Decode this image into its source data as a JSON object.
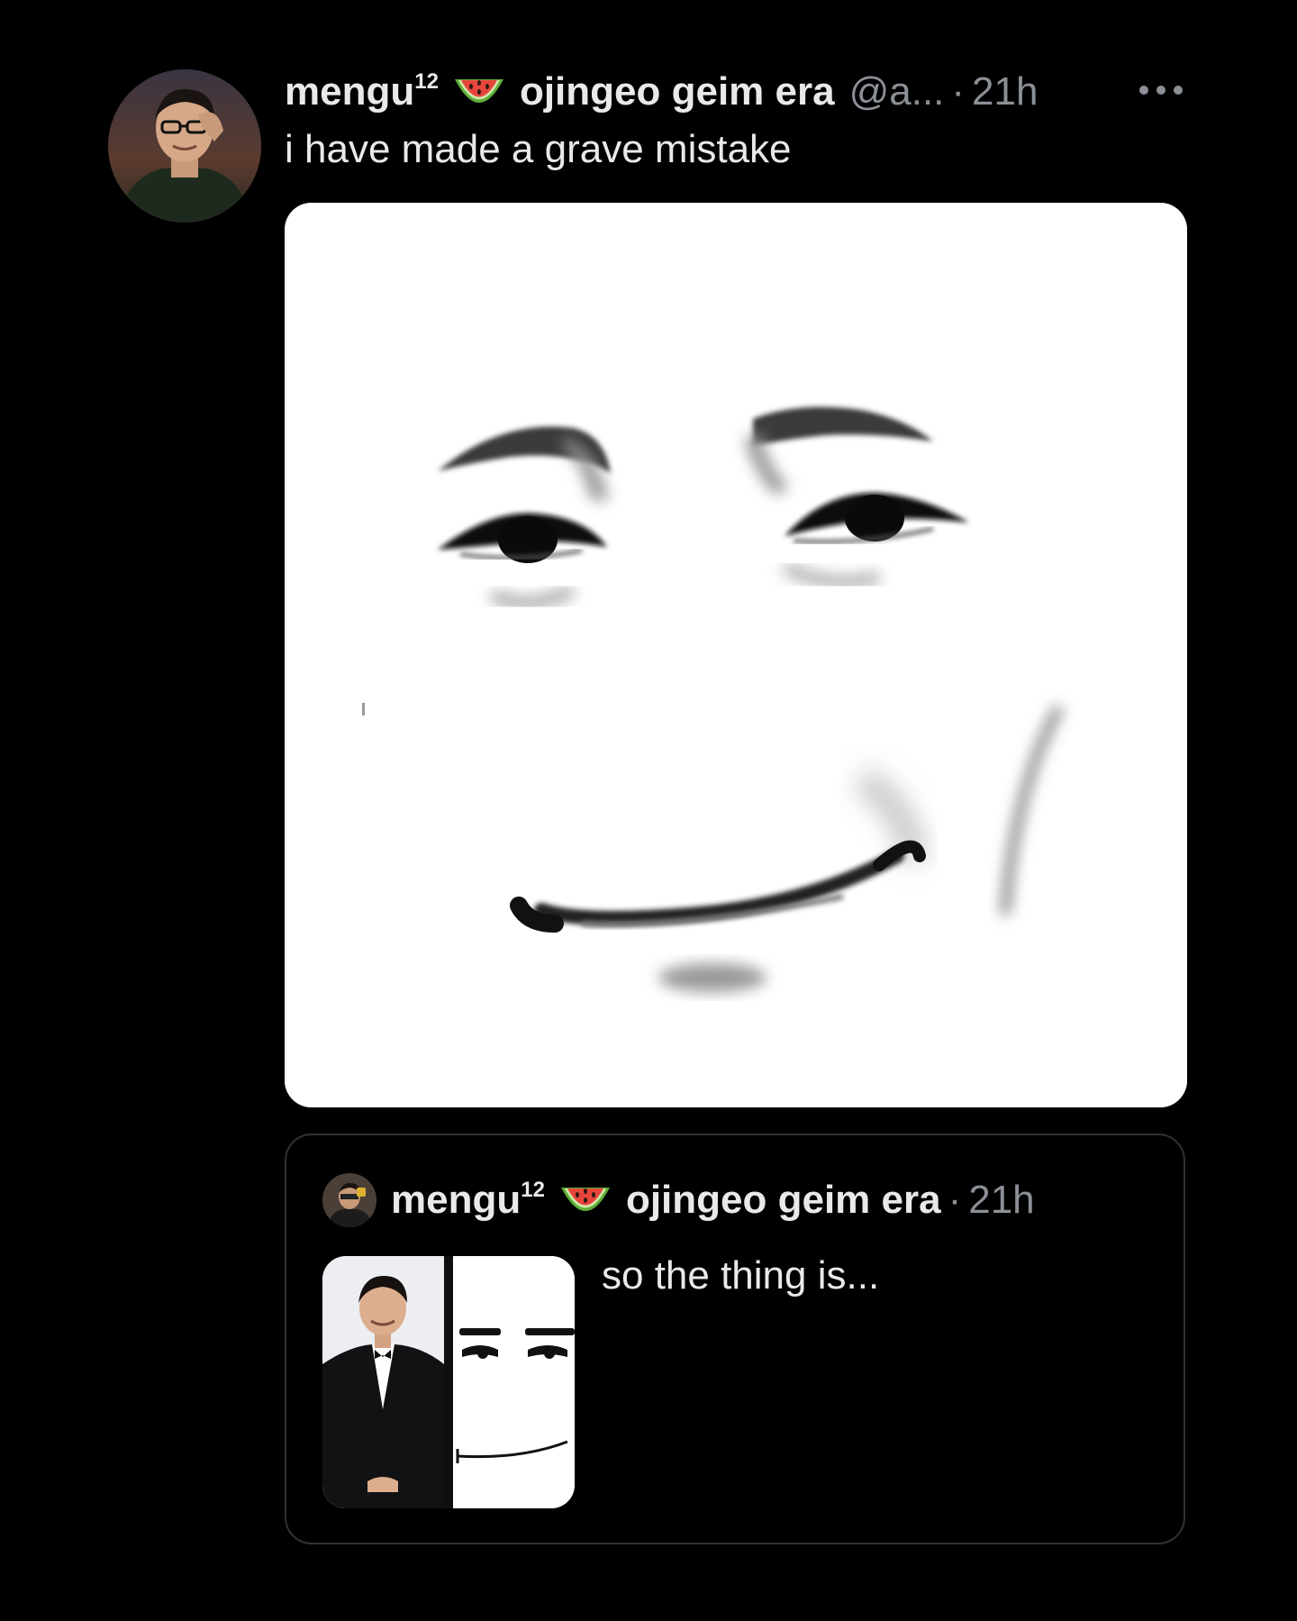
{
  "post": {
    "author": {
      "display_name": "mengu",
      "superscript": "12",
      "emoji_icon": "watermelon-icon",
      "name_suffix": "ojingeo geim era",
      "handle": "@a...",
      "separator": "·",
      "time": "21h"
    },
    "more_icon": "more-options-icon",
    "text": "i have made a grave mistake",
    "media_icon": "roblox-man-face-image"
  },
  "quote": {
    "author": {
      "display_name": "mengu",
      "superscript": "12",
      "emoji_icon": "watermelon-icon",
      "name_suffix": "ojingeo geim era",
      "separator": "·",
      "time": "21h"
    },
    "text": "so the thing is..."
  },
  "colors": {
    "background": "#000000",
    "primary_text": "#e7e9ea",
    "secondary_text": "#8b9096",
    "border": "#2f3336"
  }
}
